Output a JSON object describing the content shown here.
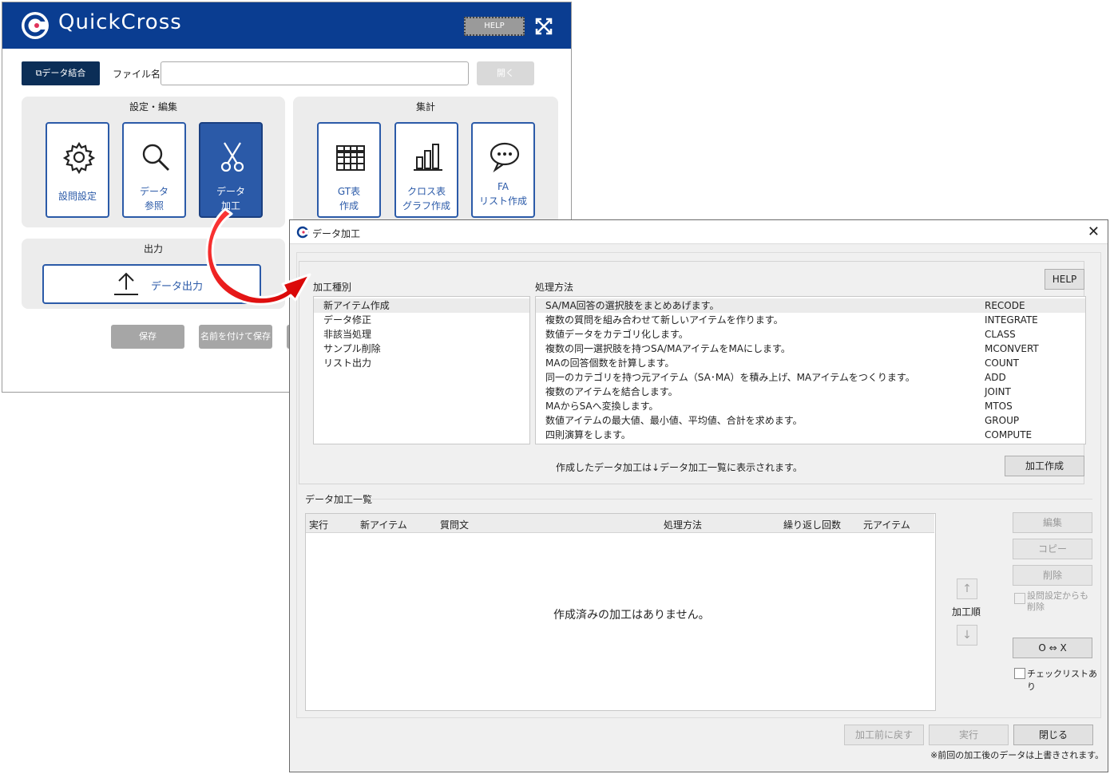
{
  "main": {
    "app_title": "QuickCross",
    "help_label": "HELP",
    "merge_label": "データ結合",
    "file_label": "ファイル名",
    "file_value": "",
    "open_label": "開く",
    "settings_panel": {
      "title": "設定・編集",
      "tiles": [
        {
          "label1": "設問設定",
          "label2": ""
        },
        {
          "label1": "データ",
          "label2": "参照"
        },
        {
          "label1": "データ",
          "label2": "加工"
        }
      ]
    },
    "aggregate_panel": {
      "title": "集計",
      "tiles": [
        {
          "label1": "GT表",
          "label2": "作成"
        },
        {
          "label1": "クロス表",
          "label2": "グラフ作成"
        },
        {
          "label1": "FA",
          "label2": "リスト作成"
        }
      ]
    },
    "output_panel": {
      "title": "出力",
      "button_label": "データ出力"
    },
    "save_label": "保存",
    "save_as_label": "名前を付けて保存"
  },
  "dialog": {
    "title": "データ加工",
    "help_label": "HELP",
    "type_header": "加工種別",
    "method_header": "処理方法",
    "types": [
      "新アイテム作成",
      "データ修正",
      "非該当処理",
      "サンプル削除",
      "リスト出力"
    ],
    "methods": [
      {
        "desc": "SA/MA回答の選択肢をまとめあげます。",
        "code": "RECODE"
      },
      {
        "desc": "複数の質問を組み合わせて新しいアイテムを作ります。",
        "code": "INTEGRATE"
      },
      {
        "desc": "数値データをカテゴリ化します。",
        "code": "CLASS"
      },
      {
        "desc": "複数の同一選択肢を持つSA/MAアイテムをMAにします。",
        "code": "MCONVERT"
      },
      {
        "desc": "MAの回答個数を計算します。",
        "code": "COUNT"
      },
      {
        "desc": "同一のカテゴリを持つ元アイテム（SA･MA）を積み上げ、MAアイテムをつくります。",
        "code": "ADD"
      },
      {
        "desc": "複数のアイテムを結合します。",
        "code": "JOINT"
      },
      {
        "desc": "MAからSAへ変換します。",
        "code": "MTOS"
      },
      {
        "desc": "数値アイテムの最大値、最小値、平均値、合計を求めます。",
        "code": "GROUP"
      },
      {
        "desc": "四則演算をします。",
        "code": "COMPUTE"
      }
    ],
    "created_note": "作成したデータ加工は↓データ加工一覧に表示されます。",
    "create_label": "加工作成",
    "list_title": "データ加工一覧",
    "columns": [
      "実行",
      "新アイテム",
      "質問文",
      "処理方法",
      "繰り返し回数",
      "元アイテム"
    ],
    "empty_message": "作成済みの加工はありません。",
    "order_label": "加工順",
    "edit_label": "編集",
    "copy_label": "コピー",
    "delete_label": "削除",
    "delete_also_label": "設問設定からも削除",
    "toggle_label": "O ⇔ X",
    "checklist_label": "チェックリストあり",
    "revert_label": "加工前に戻す",
    "run_label": "実行",
    "close_label": "閉じる",
    "overwrite_note": "※前回の加工後のデータは上書きされます。"
  }
}
